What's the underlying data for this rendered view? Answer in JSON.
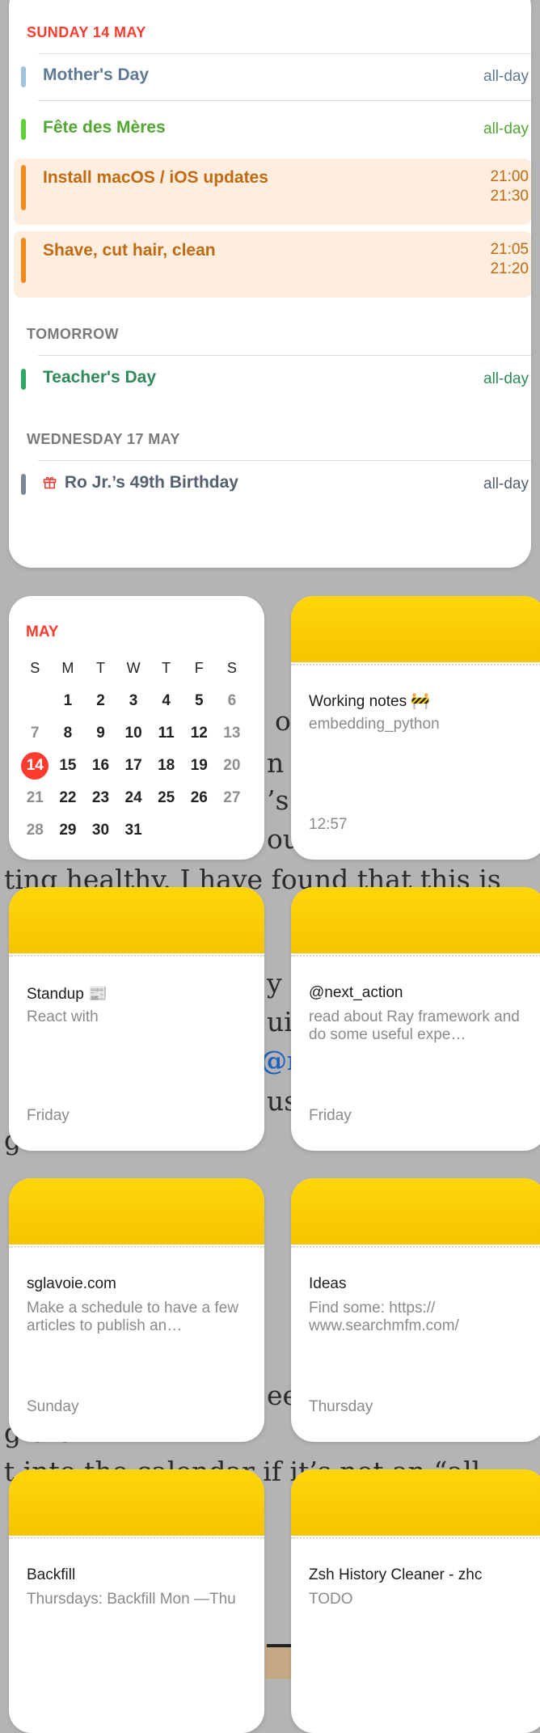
{
  "colors": {
    "red": "#ff3b30",
    "header_gray": "#7a7a7a",
    "mothers_day": "#5f7a94",
    "fete": "#52a632",
    "orange": "#c06a12",
    "orange_bar": "#f08a1c",
    "orange_tint": "#fdeee0",
    "teacher": "#2f8a5a",
    "birthday": "#55606e",
    "note_yellow": "#ffd60a"
  },
  "events_widget": {
    "sections": [
      {
        "header": "SUNDAY 14 MAY",
        "events": [
          {
            "title": "Mother's Day",
            "time": "all-day"
          },
          {
            "title": "Fête des Mères",
            "time": "all-day"
          },
          {
            "title": "Install macOS / iOS updates",
            "start": "21:00",
            "end": "21:30"
          },
          {
            "title": "Shave, cut hair, clean",
            "start": "21:05",
            "end": "21:20"
          }
        ]
      },
      {
        "header": "TOMORROW",
        "events": [
          {
            "title": "Teacher's Day",
            "time": "all-day"
          }
        ]
      },
      {
        "header": "WEDNESDAY 17 MAY",
        "events": [
          {
            "title": "Ro Jr.’s 49th Birthday",
            "time": "all-day",
            "icon": "gift-icon"
          }
        ]
      }
    ]
  },
  "month_widget": {
    "month": "MAY",
    "weekdays": [
      "S",
      "M",
      "T",
      "W",
      "T",
      "F",
      "S"
    ],
    "weeks": [
      [
        "",
        "1",
        "2",
        "3",
        "4",
        "5",
        "6"
      ],
      [
        "7",
        "8",
        "9",
        "10",
        "11",
        "12",
        "13"
      ],
      [
        "14",
        "15",
        "16",
        "17",
        "18",
        "19",
        "20"
      ],
      [
        "21",
        "22",
        "23",
        "24",
        "25",
        "26",
        "27"
      ],
      [
        "28",
        "29",
        "30",
        "31",
        "",
        "",
        ""
      ]
    ],
    "today": "14"
  },
  "notes": [
    {
      "title": "Working notes 🚧",
      "body": "embedding_python",
      "date": "12:57"
    },
    {
      "title": "Standup 📰",
      "body": "React with",
      "date": "Friday"
    },
    {
      "title": "@next_action",
      "body": "read about Ray framework and do some useful expe…",
      "date": "Friday"
    },
    {
      "title": "sglavoie.com",
      "body": "Make a schedule to have a few articles to publish an…",
      "date": "Sunday"
    },
    {
      "title": "Ideas",
      "body": "Find some: https:// www.searchmfm.com/",
      "date": "Thursday"
    },
    {
      "title": "Backfill",
      "body": "Thursdays: Backfill Mon —Thu",
      "date": ""
    },
    {
      "title": "Zsh History Cleaner - zhc",
      "body": "TODO",
      "date": ""
    }
  ],
  "background": {
    "lines": [
      "o h",
      "n c",
      "’s c",
      "oun",
      "ting healthy. I have found that this is",
      "y i",
      "uic",
      "@n",
      "us",
      "g                      on.",
      "eel",
      "g                      ort",
      "t into the calendar if it’s not an “all"
    ]
  }
}
